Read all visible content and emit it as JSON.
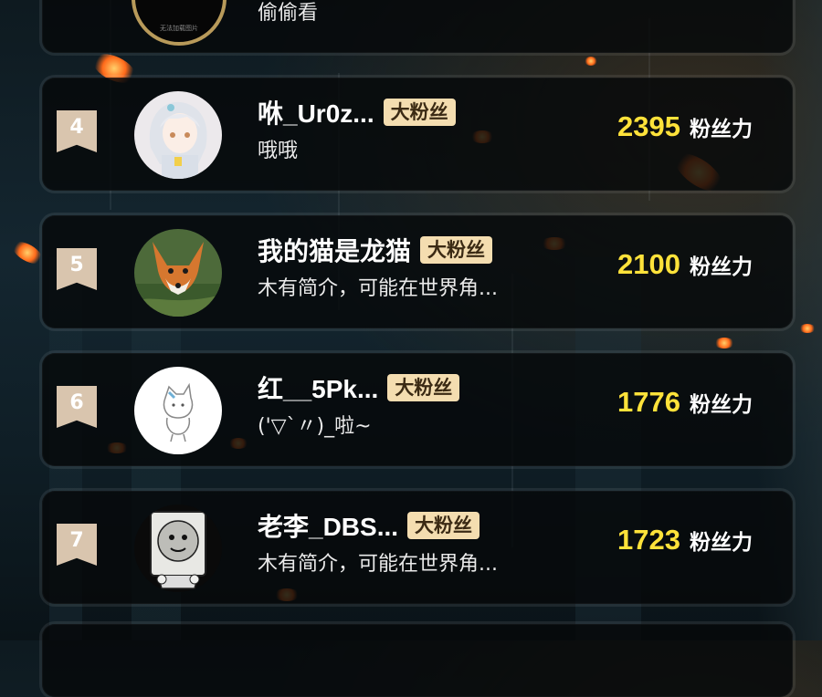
{
  "top_entry": {
    "avatar_caption": "无法加载图片",
    "bio": "偷偷看"
  },
  "score_unit": "粉丝力",
  "entries": [
    {
      "rank": "4",
      "name": "咻_Ur0z...",
      "badge": "大粉丝",
      "bio": "哦哦",
      "score": "2395"
    },
    {
      "rank": "5",
      "name": "我的猫是龙猫",
      "badge": "大粉丝",
      "bio": "木有简介，可能在世界角...",
      "score": "2100"
    },
    {
      "rank": "6",
      "name": "红__5Pk...",
      "badge": "大粉丝",
      "bio": "('▽`〃)_啦~",
      "score": "1776"
    },
    {
      "rank": "7",
      "name": "老李_DBS...",
      "badge": "大粉丝",
      "bio": "木有简介，可能在世界角...",
      "score": "1723"
    }
  ],
  "colors": {
    "score": "#ffe23a",
    "badge_bg": "#f4ddb0",
    "rank_bg": "#d9c5ae"
  }
}
